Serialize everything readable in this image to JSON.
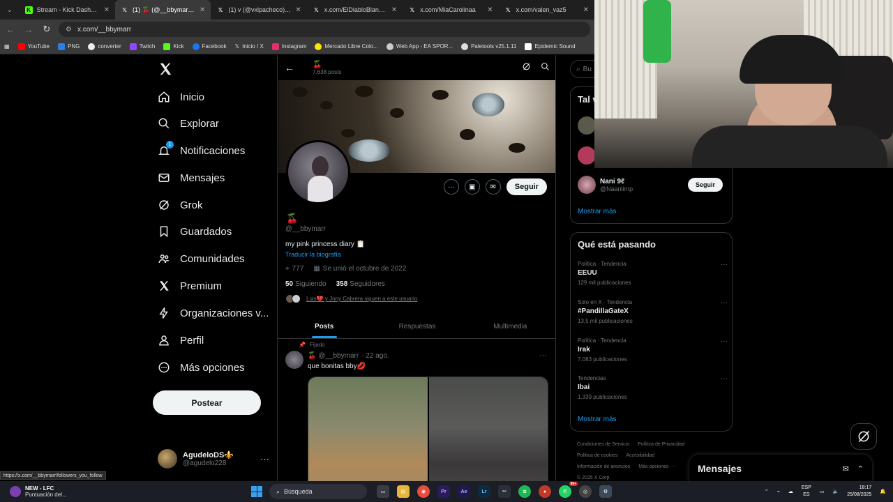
{
  "browser": {
    "tabs": [
      {
        "title": "Stream - Kick Dashboard",
        "icon": "kick-icon",
        "color": "#53fc18",
        "active": false
      },
      {
        "title": "(1) 🍒 (@__bbymarr) / X",
        "icon": "x-icon",
        "color": "#ffffff",
        "active": true
      },
      {
        "title": "(1) v (@vxlpacheco) / X",
        "icon": "x-icon",
        "color": "#ffffff",
        "active": false
      },
      {
        "title": "x.com/ElDiabloBlanco/sta",
        "icon": "x-icon",
        "color": "#ffffff",
        "active": false
      },
      {
        "title": "x.com/MiaCarolinaa",
        "icon": "x-icon",
        "color": "#ffffff",
        "active": false
      },
      {
        "title": "x.com/valen_vaz5",
        "icon": "x-icon",
        "color": "#ffffff",
        "active": false
      }
    ],
    "url": "x.com/__bbymarr",
    "bookmarks": [
      {
        "label": "YouTube",
        "color": "#ff0000"
      },
      {
        "label": "PNG",
        "color": "#2b7de9"
      },
      {
        "label": "converter",
        "color": "#eeeeee"
      },
      {
        "label": "Twitch",
        "color": "#9146ff"
      },
      {
        "label": "Kick",
        "color": "#53fc18"
      },
      {
        "label": "Facebook",
        "color": "#1877f2"
      },
      {
        "label": "Inicio / X",
        "color": "#ffffff"
      },
      {
        "label": "Instagram",
        "color": "#e1306c"
      },
      {
        "label": "Mercado Libre Colo...",
        "color": "#ffe600"
      },
      {
        "label": "Web App - EA SPOR...",
        "color": "#cccccc"
      },
      {
        "label": "Paletools v25.1.11",
        "color": "#dddddd"
      },
      {
        "label": "Epidemic Sound",
        "color": "#ffffff"
      }
    ],
    "status_url": "https://x.com/__bbymarr/followers_you_follow"
  },
  "nav": {
    "items": [
      {
        "label": "Inicio",
        "icon": "home-icon"
      },
      {
        "label": "Explorar",
        "icon": "search-icon"
      },
      {
        "label": "Notificaciones",
        "icon": "bell-icon",
        "badge": "1"
      },
      {
        "label": "Mensajes",
        "icon": "mail-icon"
      },
      {
        "label": "Grok",
        "icon": "grok-icon"
      },
      {
        "label": "Guardados",
        "icon": "bookmark-icon"
      },
      {
        "label": "Comunidades",
        "icon": "people-icon"
      },
      {
        "label": "Premium",
        "icon": "x-icon"
      },
      {
        "label": "Organizaciones v...",
        "icon": "lightning-icon"
      },
      {
        "label": "Perfil",
        "icon": "person-icon"
      },
      {
        "label": "Más opciones",
        "icon": "more-circle-icon"
      }
    ],
    "post_label": "Postear",
    "account": {
      "name": "AgudeloDS⚜️",
      "handle": "@agudelo228"
    }
  },
  "profile": {
    "header_emoji": "🍒",
    "post_count": "7.638 posts",
    "name_emoji": "🍒",
    "handle": "@__bbymarr",
    "bio": "my pink princess diary 📋",
    "translate": "Traducir la biografía",
    "location": "777",
    "joined": "Se unió el octubre de 2022",
    "following_count": "50",
    "following_label": "Siguiendo",
    "followers_count": "358",
    "followers_label": "Seguidores",
    "followed_by": "Luis💔 y Jony Cabrera siguen a este usuario",
    "follow_label": "Seguir",
    "tabs": [
      "Posts",
      "Respuestas",
      "Multimedia"
    ]
  },
  "tweet": {
    "pinned_label": "Fijado",
    "author": "🍒 @__bbymarr",
    "date": "· 22 ago.",
    "text": "que bonitas bby💋"
  },
  "sidebar": {
    "search_placeholder": "Bu",
    "who_title": "Tal v",
    "who": {
      "name": "Nani 9ℓ",
      "handle": "@Naanlimp",
      "follow": "Seguir"
    },
    "show_more_1": "Mostrar más",
    "trends_title": "Qué está pasando",
    "trends": [
      {
        "context": "Política · Tendencia",
        "name": "EEUU",
        "count": "129 mil publicaciones"
      },
      {
        "context": "Solo en X · Tendencia",
        "name": "#PandillaGateX",
        "count": "13,5 mil publicaciones"
      },
      {
        "context": "Política · Tendencia",
        "name": "Irak",
        "count": "7.083 publicaciones"
      },
      {
        "context": "Tendencias",
        "name": "Ibai",
        "count": "1.339 publicaciones"
      }
    ],
    "show_more_2": "Mostrar más",
    "footer": [
      "Condiciones de Servicio",
      "Política de Privacidad",
      "Política de cookies",
      "Accesibilidad",
      "Información de anuncios",
      "Más opciones ···",
      "© 2025 X Corp."
    ]
  },
  "messages": {
    "title": "Mensajes"
  },
  "taskbar": {
    "weather_title": "NEW - LFC",
    "weather_sub": "Puntuación del...",
    "search": "Búsqueda",
    "lang_top": "ESP",
    "lang_bottom": "ES",
    "time": "18:17",
    "date": "25/08/2025",
    "notif_badge": "99+"
  }
}
